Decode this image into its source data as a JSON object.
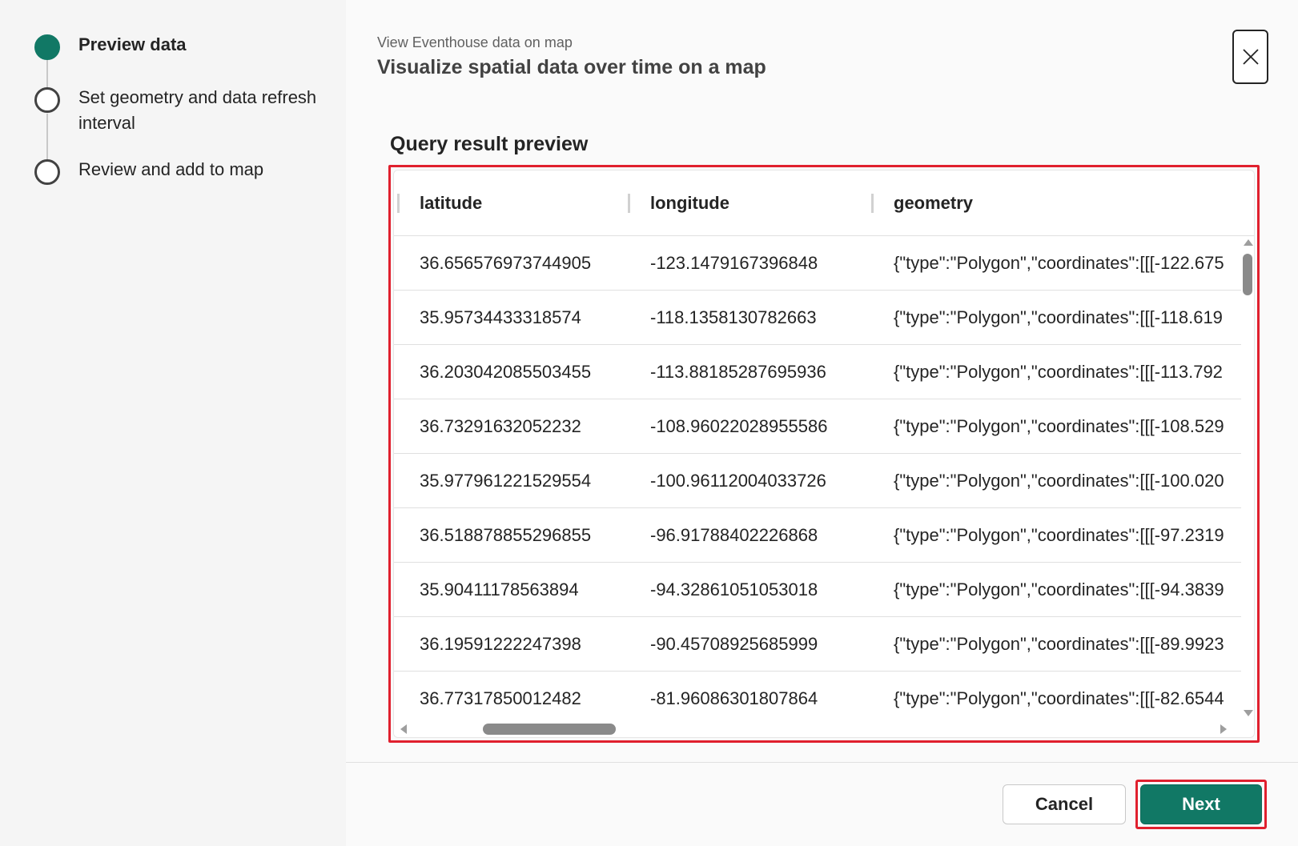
{
  "stepper": {
    "steps": [
      {
        "label": "Preview data",
        "active": true
      },
      {
        "label": "Set geometry and data refresh interval",
        "active": false
      },
      {
        "label": "Review and add to map",
        "active": false
      }
    ]
  },
  "header": {
    "subtitle": "View Eventhouse data on map",
    "title": "Visualize spatial data over time on a map",
    "close_icon": "close-icon"
  },
  "preview": {
    "section_title": "Query result preview",
    "columns": [
      "latitude",
      "longitude",
      "geometry"
    ],
    "rows": [
      [
        "36.656576973744905",
        "-123.1479167396848",
        "{\"type\":\"Polygon\",\"coordinates\":[[[-122.675"
      ],
      [
        "35.95734433318574",
        "-118.1358130782663",
        "{\"type\":\"Polygon\",\"coordinates\":[[[-118.619"
      ],
      [
        "36.203042085503455",
        "-113.88185287695936",
        "{\"type\":\"Polygon\",\"coordinates\":[[[-113.792"
      ],
      [
        "36.73291632052232",
        "-108.96022028955586",
        "{\"type\":\"Polygon\",\"coordinates\":[[[-108.529"
      ],
      [
        "35.977961221529554",
        "-100.96112004033726",
        "{\"type\":\"Polygon\",\"coordinates\":[[[-100.020"
      ],
      [
        "36.518878855296855",
        "-96.91788402226868",
        "{\"type\":\"Polygon\",\"coordinates\":[[[-97.2319"
      ],
      [
        "35.90411178563894",
        "-94.32861051053018",
        "{\"type\":\"Polygon\",\"coordinates\":[[[-94.3839"
      ],
      [
        "36.19591222247398",
        "-90.45708925685999",
        "{\"type\":\"Polygon\",\"coordinates\":[[[-89.9923"
      ],
      [
        "36.77317850012482",
        "-81.96086301807864",
        "{\"type\":\"Polygon\",\"coordinates\":[[[-82.6544"
      ]
    ]
  },
  "footer": {
    "cancel_label": "Cancel",
    "next_label": "Next"
  },
  "colors": {
    "accent": "#117865",
    "highlight": "#e0202e"
  }
}
